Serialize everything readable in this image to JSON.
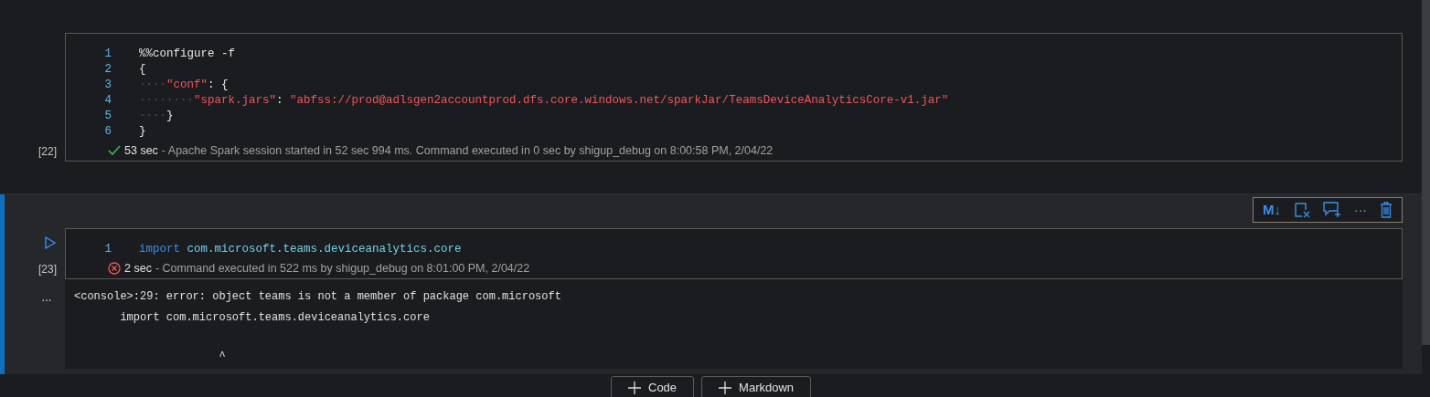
{
  "cells": [
    {
      "selected": false,
      "exec_count": "[22]",
      "lines": [
        {
          "number": "1",
          "tokens": [
            {
              "kind": "plain",
              "text": "%%configure -f"
            }
          ]
        },
        {
          "number": "2",
          "tokens": [
            {
              "kind": "plain",
              "text": "{"
            }
          ]
        },
        {
          "number": "3",
          "tokens": [
            {
              "kind": "space",
              "text": "····"
            },
            {
              "kind": "string",
              "text": "\"conf\""
            },
            {
              "kind": "plain",
              "text": ": {"
            }
          ]
        },
        {
          "number": "4",
          "tokens": [
            {
              "kind": "space",
              "text": "········"
            },
            {
              "kind": "string",
              "text": "\"spark.jars\""
            },
            {
              "kind": "plain",
              "text": ": "
            },
            {
              "kind": "string",
              "text": "\"abfss://prod@adlsgen2accountprod.dfs.core.windows.net/sparkJar/TeamsDeviceAnalyticsCore-v1.jar\""
            }
          ]
        },
        {
          "number": "5",
          "tokens": [
            {
              "kind": "space",
              "text": "····"
            },
            {
              "kind": "plain",
              "text": "}"
            }
          ]
        },
        {
          "number": "6",
          "tokens": [
            {
              "kind": "plain",
              "text": "}"
            }
          ]
        }
      ],
      "status": {
        "kind": "success",
        "duration": "53 sec",
        "message": "- Apache Spark session started in 52 sec 994 ms. Command executed in 0 sec by shigup_debug on 8:00:58 PM, 2/04/22"
      }
    },
    {
      "selected": true,
      "exec_count": "[23]",
      "more": "···",
      "toolbar": [
        {
          "kind": "markdown",
          "text": "M↓"
        },
        {
          "kind": "clear"
        },
        {
          "kind": "comment"
        },
        {
          "kind": "more",
          "text": "···"
        },
        {
          "kind": "delete"
        }
      ],
      "lines": [
        {
          "number": "1",
          "tokens": [
            {
              "kind": "keyword",
              "text": "import"
            },
            {
              "kind": "ident",
              "text": "com.microsoft.teams.deviceanalytics.core"
            }
          ]
        }
      ],
      "status": {
        "kind": "error",
        "duration": "2 sec",
        "message": "- Command executed in 522 ms by shigup_debug on 8:01:00 PM, 2/04/22"
      },
      "output": [
        {
          "kind": "line",
          "text": "<console>:29: error: object teams is not a member of package com.microsoft"
        },
        {
          "kind": "line",
          "text": "       import com.microsoft.teams.deviceanalytics.core"
        },
        {
          "kind": "caret",
          "text": "                      ^"
        }
      ]
    }
  ],
  "add_buttons": [
    {
      "label": "Code"
    },
    {
      "label": "Markdown"
    }
  ]
}
